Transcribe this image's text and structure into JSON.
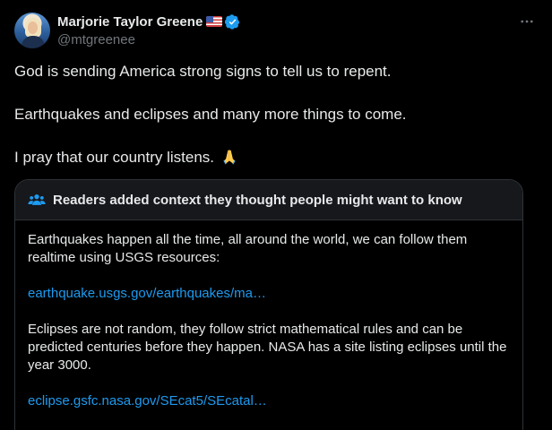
{
  "author": {
    "display_name": "Marjorie Taylor Greene",
    "flag": "us-flag-emoji",
    "badge": "verified-badge-icon",
    "handle": "@mtgreenee"
  },
  "tweet": {
    "line1": "God is sending America strong signs to tell us to repent.",
    "line2": "Earthquakes and eclipses and many more things to come.",
    "line3": "I pray that our country listens.",
    "emoji": "folded-hands-emoji"
  },
  "community_note": {
    "title": "Readers added context they thought people might want to know",
    "paragraph1": "Earthquakes happen all the time, all around the world, we can follow them realtime using USGS resources:",
    "link1": "earthquake.usgs.gov/earthquakes/ma…",
    "paragraph2": "Eclipses are not random, they follow strict mathematical rules and can be predicted centuries before they happen. NASA has a site listing eclipses until the year 3000.",
    "link2": "eclipse.gsfc.nasa.gov/SEcat5/SEcatal…"
  },
  "colors": {
    "background": "#000000",
    "text": "#e7e9ea",
    "secondary_text": "#71767b",
    "link": "#1d9bf0",
    "border": "#2f3336",
    "note_header_bg": "#16181c",
    "verified": "#1d9bf0"
  }
}
